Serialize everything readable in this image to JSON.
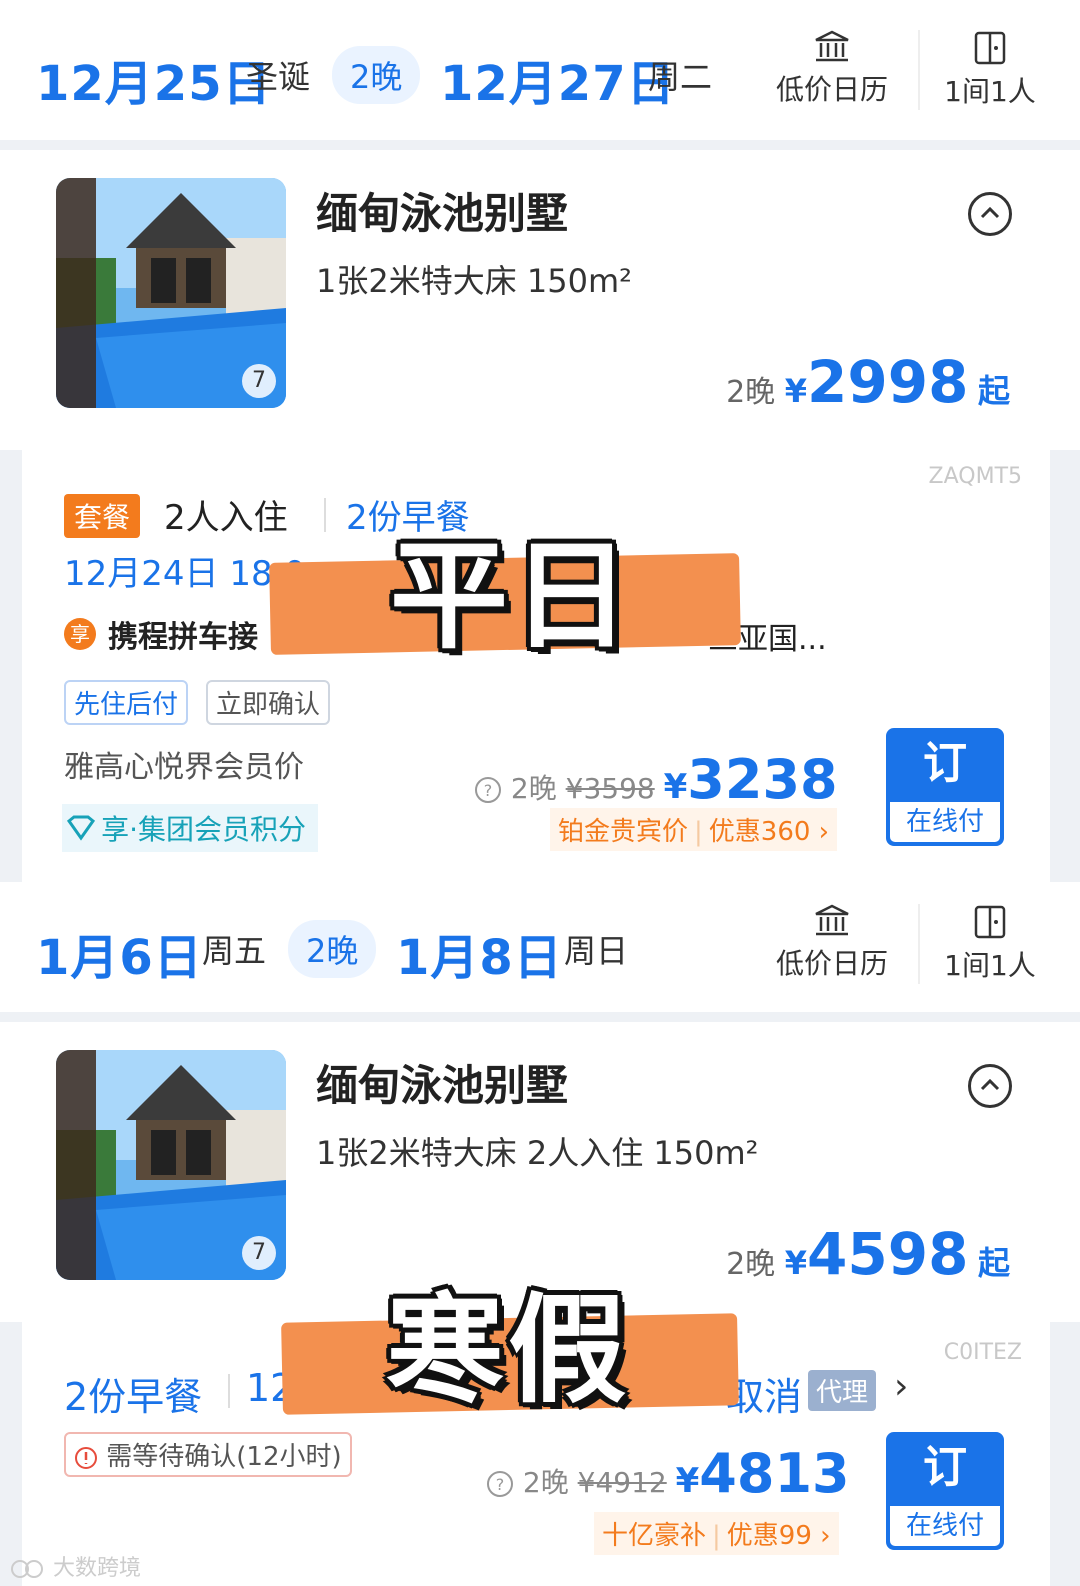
{
  "section1": {
    "header": {
      "checkin_date": "12月25日",
      "checkin_week": "圣诞",
      "nights": "2晚",
      "checkout_date": "12月27日",
      "checkout_week": "周二",
      "calendar_label": "低价日历",
      "rooms_label": "1间1人"
    },
    "room": {
      "name": "缅甸泳池别墅",
      "desc": "1张2米特大床  150m²",
      "photo_count": "7",
      "nights": "2晚",
      "currency": "¥",
      "price": "2998",
      "from": "起"
    },
    "offer": {
      "code": "ZAQMT5",
      "package_tag": "套餐",
      "occupancy": "2人入住",
      "breakfast": "2份早餐",
      "cancel_deadline": "12月24日 18:0",
      "transfer_badge": "享",
      "transfer_text": "携程拼车接",
      "transfer_tail": "三亚国...",
      "tags": [
        "先住后付",
        "立即确认"
      ],
      "member_price": "雅高心悦界会员价",
      "member_points": "享·集团会员积分",
      "nights": "2晚",
      "original_price": "¥3598",
      "currency": "¥",
      "price": "3238",
      "promo_label": "铂金贵宾价",
      "promo_discount": "优惠360",
      "book_label": "订",
      "pay_label": "在线付"
    },
    "overlay_text": "平日"
  },
  "section2": {
    "header": {
      "checkin_date": "1月6日",
      "checkin_week": "周五",
      "nights": "2晚",
      "checkout_date": "1月8日",
      "checkout_week": "周日",
      "calendar_label": "低价日历",
      "rooms_label": "1间1人"
    },
    "room": {
      "name": "缅甸泳池别墅",
      "desc": "1张2米特大床  2人入住  150m²",
      "photo_count": "7",
      "nights": "2晚",
      "currency": "¥",
      "price": "4598",
      "from": "起"
    },
    "offer": {
      "code": "C0ITEZ",
      "breakfast": "2份早餐",
      "partial": "12",
      "cancel_tail": "取消",
      "agent_tag": "代理",
      "wait_notice": "需等待确认(12小时)",
      "nights": "2晚",
      "original_price": "¥4912",
      "currency": "¥",
      "price": "4813",
      "promo_label": "十亿豪补",
      "promo_discount": "优惠99",
      "book_label": "订",
      "pay_label": "在线付"
    },
    "overlay_text": "寒假"
  },
  "watermark": "大数跨境",
  "colors": {
    "accent": "#1a73e8",
    "orange": "#f37b1d",
    "highlight": "#f3904f"
  }
}
